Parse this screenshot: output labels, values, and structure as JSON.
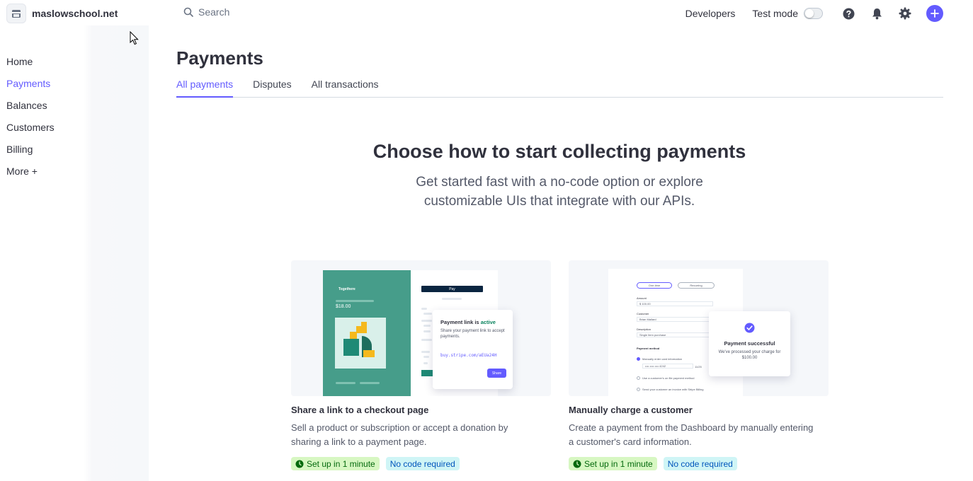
{
  "account": {
    "name": "maslowschool.net"
  },
  "search": {
    "placeholder": "Search"
  },
  "topbar": {
    "developers": "Developers",
    "test_mode": "Test mode"
  },
  "sidebar": {
    "items": [
      {
        "label": "Home"
      },
      {
        "label": "Payments"
      },
      {
        "label": "Balances"
      },
      {
        "label": "Customers"
      },
      {
        "label": "Billing"
      },
      {
        "label": "More +"
      }
    ]
  },
  "page": {
    "title": "Payments"
  },
  "tabs": [
    {
      "label": "All payments"
    },
    {
      "label": "Disputes"
    },
    {
      "label": "All transactions"
    }
  ],
  "hero": {
    "title": "Choose how to start collecting payments",
    "subtitle": "Get started fast with a no-code option or explore customizable UIs that integrate with our APIs."
  },
  "cards": [
    {
      "title": "Share a link to a checkout page",
      "description": "Sell a product or subscription or accept a donation by sharing a link to a payment page.",
      "badge_time": "Set up in 1 minute",
      "badge_code": "No code required",
      "illustration": {
        "brand": "Togethere",
        "price": "$18.00",
        "pay_button": "Pay",
        "popup_title": "Payment link is",
        "popup_status": "active",
        "popup_text": "Share your payment link to accept payments.",
        "popup_link": "buy.stripe.com/aEUa24H",
        "share_button": "Share"
      }
    },
    {
      "title": "Manually charge a customer",
      "description": "Create a payment from the Dashboard by manually entering a customer's card information.",
      "badge_time": "Set up in 1 minute",
      "badge_code": "No code required",
      "illustration": {
        "tab_one_time": "One-time",
        "tab_recurring": "Recurring",
        "amount_label": "Amount",
        "amount_value": "$ 100.00",
        "customer_label": "Customer",
        "customer_value": "Brian Mallard",
        "description_label": "Description",
        "description_value": "Single item purchase",
        "method_label": "Payment method",
        "method_manual": "Manually enter card information",
        "card_number": "•••• •••• •••• 4242",
        "card_expiry": "11/25",
        "method_on_file": "Use a customer's on file payment method",
        "method_email": "Send your customer an invoice with Stripe Billing",
        "popup_title": "Payment successful",
        "popup_text": "We've processed your charge for $100.00"
      }
    }
  ],
  "colors": {
    "accent": "#635bff",
    "badge_green": "#d7f7c2",
    "badge_blue": "#cff5f6",
    "illustration_green": "#469d8a"
  }
}
